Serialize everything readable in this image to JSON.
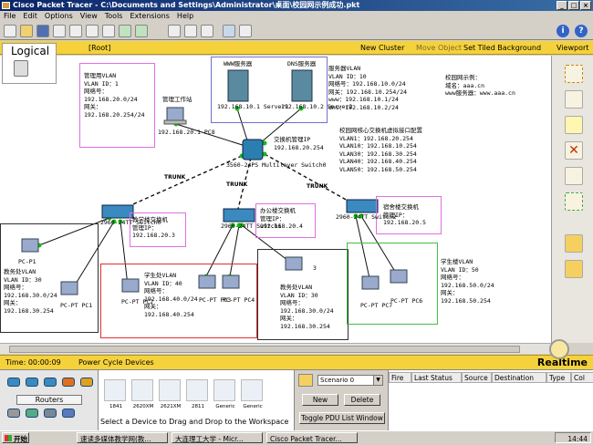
{
  "window": {
    "title": "Cisco Packet Tracer - C:\\Documents and Settings\\Administrator\\桌面\\校园网示例成功.pkt"
  },
  "menu": [
    "File",
    "Edit",
    "Options",
    "View",
    "Tools",
    "Extensions",
    "Help"
  ],
  "toolbar": {
    "info_label": "i",
    "help_label": "?"
  },
  "nav": {
    "logical": "Logical",
    "root": "[Root]",
    "new_cluster": "New Cluster",
    "move_object": "Move Object",
    "tiled_background": "Set Tiled Background",
    "viewport": "Viewport"
  },
  "devices": {
    "pc8": "192.168.20.1\nPC8",
    "server1": "192.168.10.1\nServer1",
    "server2": "192.168.10.2\nServer2",
    "core": "3560-24PS\nMultilayer Switch0",
    "sw_left": "2960-24TT\nSwitch0",
    "sw_mid": "2960-24TT\nSwitch1",
    "sw_right": "2960-24TT\nSwitch2",
    "pc_p1": "PC-P1",
    "pc1": "PC-PT\nPC1",
    "pc2": "PC-PT\nPC2",
    "pc3": "PC-PT\nPC3",
    "pc4": "PC-PT\nPC4",
    "pc5": "3",
    "pc7": "PC-PT\nPC7",
    "pc6": "PC-PT\nPC6"
  },
  "annotations": {
    "mgmt_vlan": "管理用VLAN\nVLAN ID：1\n网络号：\n192.168.20.0/24\n网关：\n192.168.20.254/24",
    "mgmt_ws": "管理工作站",
    "www_server": "WWW服务器",
    "dns_server": "DNS服务器",
    "server_vlan": "服务器VLAN\nVLAN ID：10\n网络号：192.168.10.0/24\n网关：192.168.10.254/24\nwww：192.168.10.1/24\ndns：192.168.10.2/24",
    "campus": "校园网示例：\n域名：aaa.cn\nwww服务器：www.aaa.cn",
    "core_mgmt": "交换机管理IP\n192.168.20.254",
    "core_vif": "校园网核心交换机虚拟接口配置\nVLAN1：192.168.20.254\nVLAN10：192.168.10.254\nVLAN30：192.168.30.254\nVLAN40：192.168.40.254\nVLAN50：192.168.50.254",
    "teach_sw": "教学楼交换机\n管理IP：\n192.168.20.3",
    "office_sw": "办公楼交换机\n管理IP：\n192.168.20.4",
    "dorm_sw": "宿舍楼交换机\n管理IP：\n192.168.20.5",
    "teacher_vlan": "教务处VLAN\nVLAN ID：30\n网络号：\n192.168.30.0/24\n网关：\n192.168.30.254",
    "student_vlan": "学生处VLAN\nVLAN ID：40\n网络号：\n192.168.40.0/24\n网关：\n192.168.40.254",
    "office_vlan": "教务处VLAN\nVLAN ID：30\n网络号：\n192.168.30.0/24\n网关：\n192.168.30.254",
    "dorm_vlan": "学生楼VLAN\nVLAN ID：50\n网络号：\n192.168.50.0/24\n网关：\n192.168.50.254",
    "trunk": "TRUNK"
  },
  "timebar": {
    "time": "Time: 00:00:09",
    "power_cycle": "Power Cycle Devices",
    "mode": "Realtime"
  },
  "device_panel": {
    "category": "Routers",
    "models": [
      "1841",
      "2620XM",
      "2621XM",
      "2811",
      "Generic",
      "Generic"
    ],
    "hint": "Select a Device to Drag and Drop to the Workspace"
  },
  "scenario": {
    "selected": "Scenario 0",
    "new": "New",
    "delete": "Delete",
    "toggle": "Toggle PDU List Window"
  },
  "pdu_columns": [
    "Fire",
    "Last Status",
    "Source",
    "Destination",
    "Type",
    "Col"
  ],
  "taskbar": {
    "start": "开始",
    "tasks": [
      "速读多媒体教学网(教...",
      "大连理工大学 - Micr...",
      "Cisco Packet Tracer..."
    ],
    "clock": "14:44"
  },
  "colors": {
    "nav": "#f5d23c",
    "mgmt_box": "#e070e0",
    "server_box": "#7070d0",
    "student_box": "#e03030",
    "office_box": "#303030",
    "dorm_box": "#40c040",
    "link_ok": "#10c010"
  }
}
